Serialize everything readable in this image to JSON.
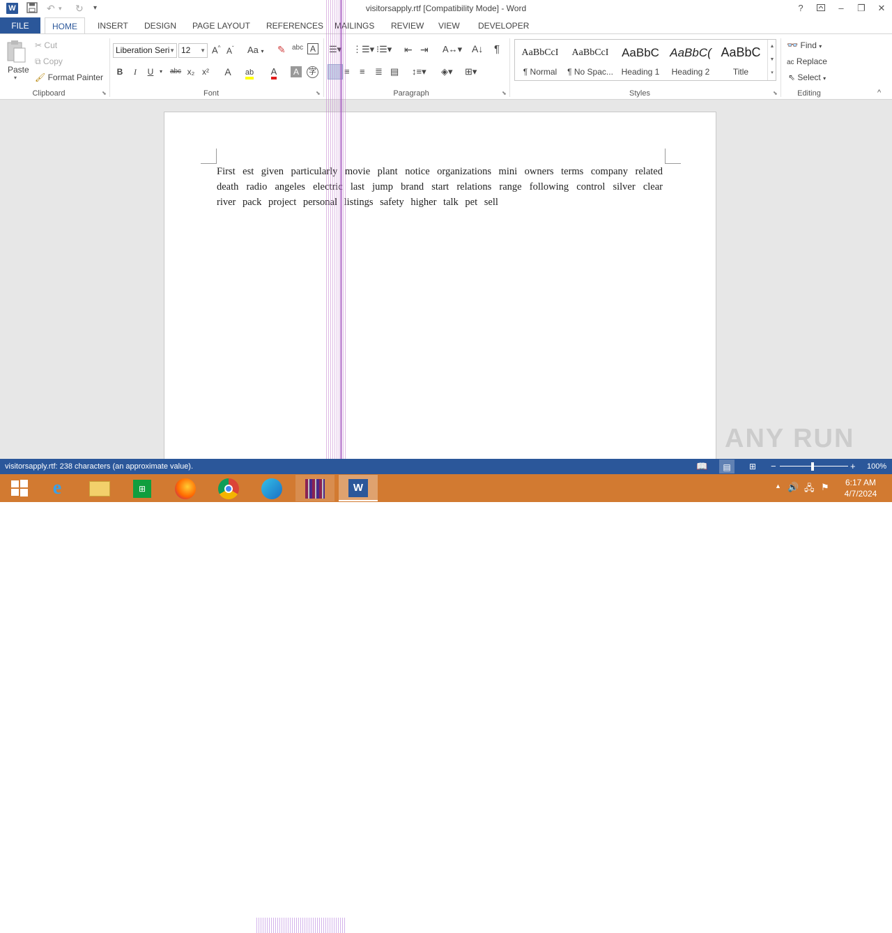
{
  "window": {
    "title": "visitorsapply.rtf [Compatibility Mode] - Word",
    "app_icon": "W",
    "help": "?",
    "minimize": "–",
    "restore": "❐",
    "close": "✕"
  },
  "qat": {
    "save": "💾",
    "undo": "↶",
    "redo": "↻",
    "customize": "⊽"
  },
  "tabs": [
    "FILE",
    "HOME",
    "INSERT",
    "DESIGN",
    "PAGE LAYOUT",
    "REFERENCES",
    "MAILINGS",
    "REVIEW",
    "VIEW",
    "DEVELOPER"
  ],
  "clipboard": {
    "paste": "Paste",
    "cut": "Cut",
    "copy": "Copy",
    "format_painter": "Format Painter",
    "label": "Clipboard"
  },
  "font": {
    "name": "Liberation Seri",
    "size": "12",
    "label": "Font",
    "bold": "B",
    "italic": "I",
    "underline": "U",
    "strike": "abc",
    "subscript": "x₂",
    "superscript": "x²",
    "grow": "A^",
    "shrink": "Aˇ",
    "case": "Aa"
  },
  "paragraph": {
    "label": "Paragraph",
    "pilcrow": "¶"
  },
  "styles": {
    "label": "Styles",
    "items": [
      {
        "preview": "AaBbCcI",
        "name": "¶ Normal"
      },
      {
        "preview": "AaBbCcI",
        "name": "¶ No Spac..."
      },
      {
        "preview": "AaBbC",
        "name": "Heading 1"
      },
      {
        "preview": "AaBbC(",
        "name": "Heading 2"
      },
      {
        "preview": "AaBbC",
        "name": "Title"
      }
    ]
  },
  "editing": {
    "find": "Find",
    "replace": "Replace",
    "select": "Select",
    "label": "Editing"
  },
  "document": {
    "text": "First   est   given particularly     movie   plant notice organizations   mini owners   terms company related         death radio angeles electric     last jump brand   start     relations range following control   silver   clear   river   pack   project personal   listings safety higher   talk pet sell"
  },
  "status": {
    "left": "visitorsapply.rtf: 238 characters (an approximate value).",
    "zoom": "100%"
  },
  "taskbar": {
    "time": "6:17 AM",
    "date": "4/7/2024"
  },
  "watermark": "ANY RUN",
  "colors": {
    "word_blue": "#2b579a",
    "taskbar": "#d27a31"
  }
}
